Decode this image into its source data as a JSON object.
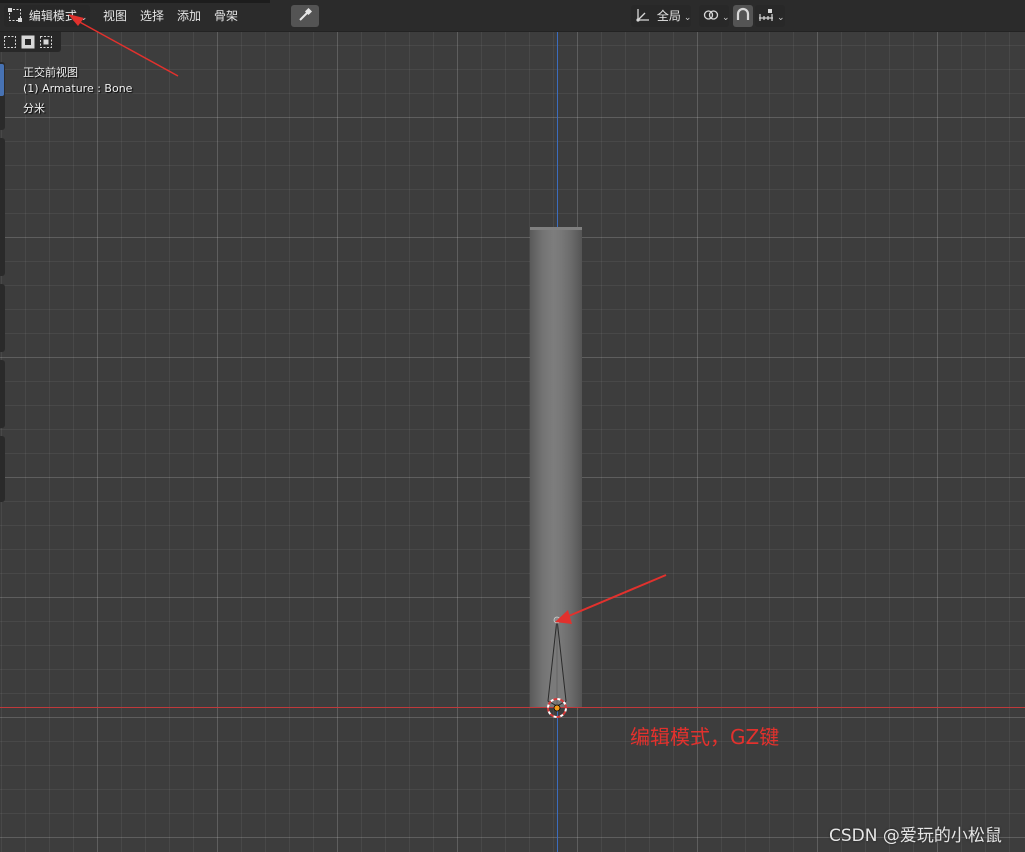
{
  "header": {
    "mode_label": "编辑模式",
    "menus": [
      "视图",
      "选择",
      "添加",
      "骨架"
    ],
    "orientation_label": "全局"
  },
  "overlay": {
    "view_name": "正交前视图",
    "object_info": "(1) Armature : Bone",
    "units": "分米"
  },
  "annotation": "编辑模式，GZ键",
  "watermark": "CSDN @爱玩的小松鼠",
  "colors": {
    "x_axis": "#c0393b",
    "y_axis": "#3b6fc4",
    "annotation_red": "#e2312d",
    "active_tool": "#4772b3"
  }
}
